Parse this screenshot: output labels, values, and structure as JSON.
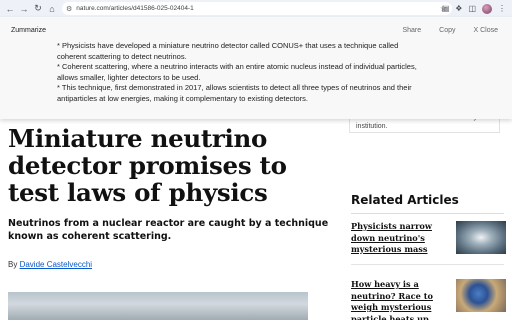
{
  "browser": {
    "url": "nature.com/articles/d41586-025-02404-1"
  },
  "overlay": {
    "title": "Zummarize",
    "actions": {
      "share": "Share",
      "copy": "Copy",
      "close": "X Close"
    },
    "lines": [
      "* Physicists have developed a miniature neutrino detector called CONUS+ that uses a technique called",
      "coherent scattering to detect neutrinos.",
      "* Coherent scattering, where a neutrino interacts with an entire atomic nucleus instead of individual particles,",
      "allows smaller, lighter detectors to be used.",
      "* This technique, first demonstrated in 2017, allows scientists to detect all three types of neutrinos and their",
      "antiparticles at low energies, making it complementary to existing detectors."
    ]
  },
  "article": {
    "headline": "Miniature neutrino detector promises to test laws of physics",
    "standfirst": "Neutrinos from a nuclear reactor are caught by a technique known as coherent scattering.",
    "byline_prefix": "By ",
    "author": "Davide Castelvecchi"
  },
  "sidebar": {
    "access_text": "You have full access to this article via your institution.",
    "related_title": "Related Articles",
    "related": [
      {
        "title": "Physicists narrow down neutrino's mysterious mass"
      },
      {
        "title": "How heavy is a neutrino? Race to weigh mysterious particle heats up"
      }
    ]
  }
}
